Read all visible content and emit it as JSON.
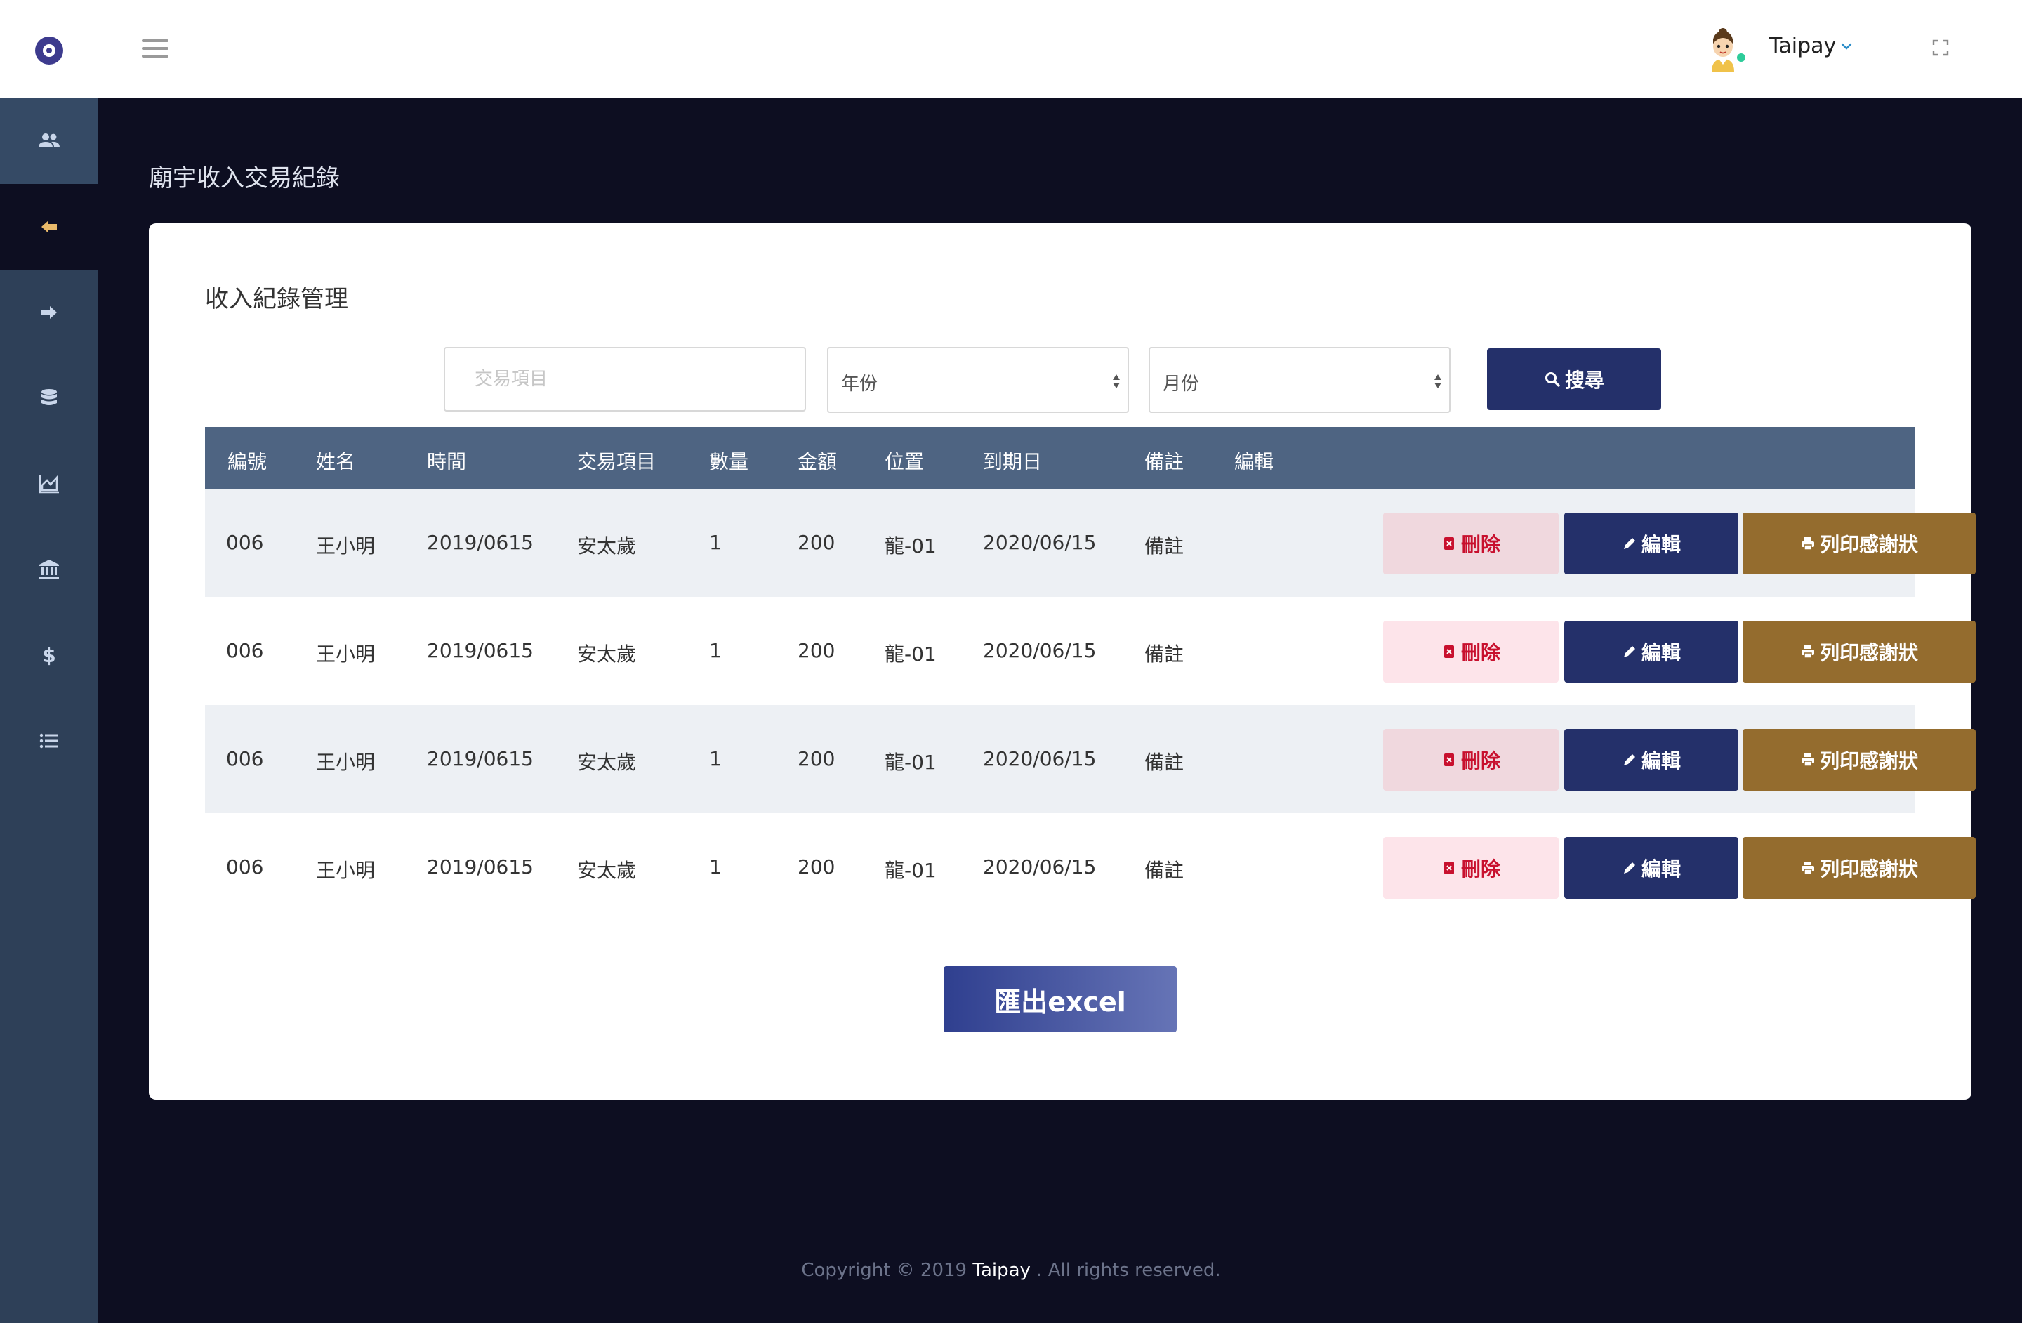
{
  "header": {
    "user_name": "Taipay",
    "icons": [
      "logo-icon",
      "hamburger-icon",
      "avatar",
      "chevron-down-icon",
      "fullscreen-icon"
    ]
  },
  "sidebar": {
    "items": [
      {
        "icon": "users-icon",
        "active": false
      },
      {
        "icon": "arrow-left-icon",
        "active": true
      },
      {
        "icon": "arrow-right-icon",
        "active": false
      },
      {
        "icon": "database-icon",
        "active": false
      },
      {
        "icon": "area-chart-icon",
        "active": false
      },
      {
        "icon": "bank-icon",
        "active": false
      },
      {
        "icon": "dollar-icon",
        "active": false
      },
      {
        "icon": "list-icon",
        "active": false
      }
    ]
  },
  "page": {
    "title": "廟宇收入交易紀錄"
  },
  "card": {
    "title": "收入紀錄管理",
    "filters": {
      "item_placeholder": "交易項目",
      "year_value": "年份",
      "month_value": "月份",
      "search_label": "搜尋"
    },
    "table": {
      "columns": [
        "編號",
        "姓名",
        "時間",
        "交易項目",
        "數量",
        "金額",
        "位置",
        "到期日",
        "備註",
        "編輯"
      ],
      "rows": [
        [
          "006",
          "王小明",
          "2019/0615",
          "安太歲",
          "1",
          "200",
          "龍-01",
          "2020/06/15",
          "備註"
        ],
        [
          "006",
          "王小明",
          "2019/0615",
          "安太歲",
          "1",
          "200",
          "龍-01",
          "2020/06/15",
          "備註"
        ],
        [
          "006",
          "王小明",
          "2019/0615",
          "安太歲",
          "1",
          "200",
          "龍-01",
          "2020/06/15",
          "備註"
        ],
        [
          "006",
          "王小明",
          "2019/0615",
          "安太歲",
          "1",
          "200",
          "龍-01",
          "2020/06/15",
          "備註"
        ]
      ],
      "actions": {
        "delete_label": "刪除",
        "edit_label": "編輯",
        "print_label": "列印感謝狀"
      }
    },
    "export_label": "匯出excel"
  },
  "footer": {
    "prefix": "Copyright © 2019",
    "brand": "Taipay",
    "suffix": ". All rights reserved."
  },
  "colors": {
    "sidebar": "#2e4058",
    "background": "#0d0e21",
    "table_header": "#4e6482",
    "primary_button": "#24306a",
    "print_button": "#946c2e",
    "delete_text": "#c8102e",
    "active_icon": "#e8b96a"
  }
}
